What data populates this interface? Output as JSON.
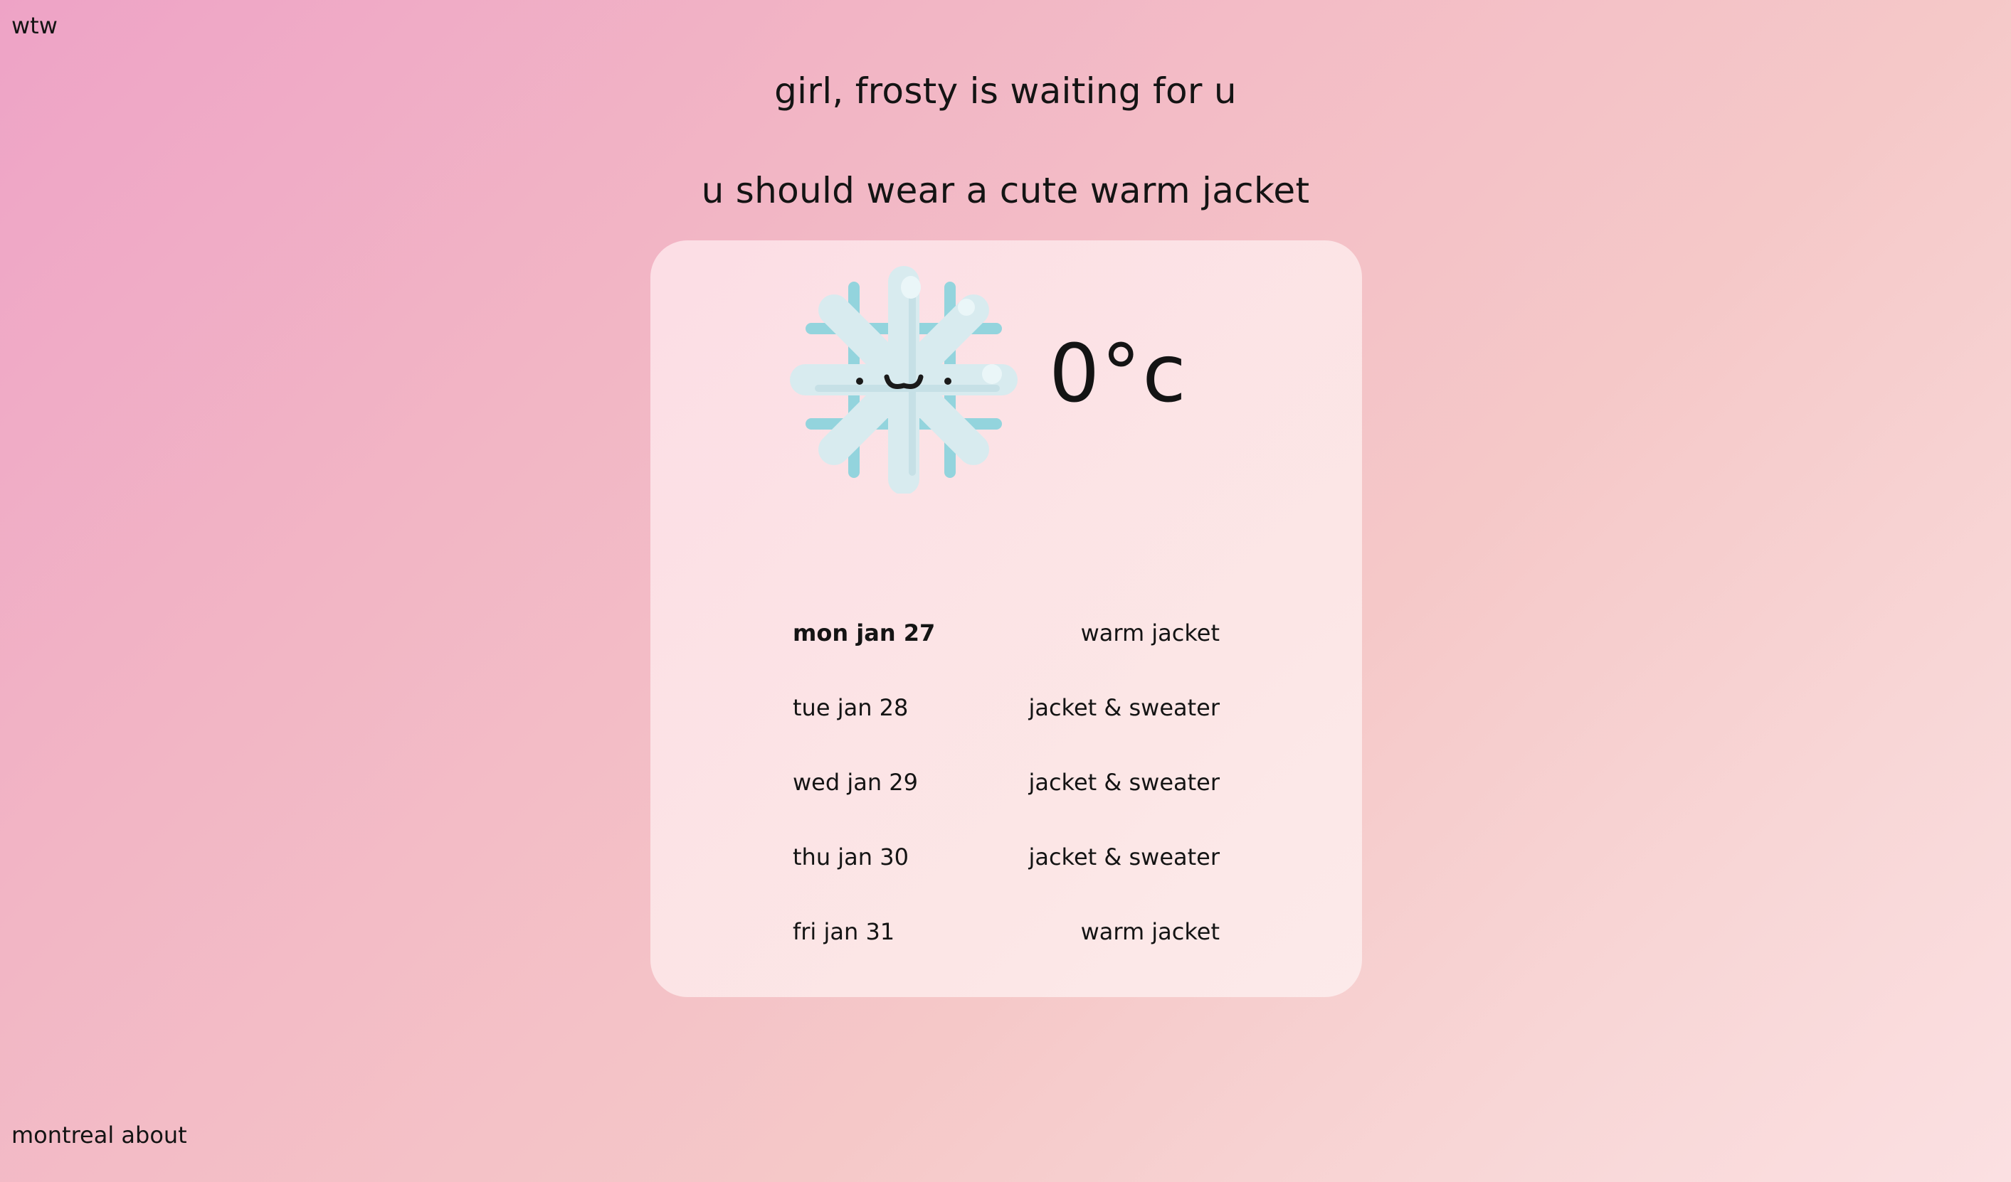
{
  "header": {
    "logo": "wtw"
  },
  "headline": {
    "line1": "girl, frosty is waiting for u",
    "line2": "u should wear a cute warm jacket"
  },
  "current": {
    "icon": "snowflake-face-icon",
    "temperature": "0°c"
  },
  "forecast": [
    {
      "day": "mon jan 27",
      "wear": "warm jacket"
    },
    {
      "day": "tue jan 28",
      "wear": "jacket & sweater"
    },
    {
      "day": "wed jan 29",
      "wear": "jacket & sweater"
    },
    {
      "day": "thu jan 30",
      "wear": "jacket & sweater"
    },
    {
      "day": "fri jan 31",
      "wear": "warm jacket"
    }
  ],
  "footer": {
    "city": "montreal",
    "about": "about"
  },
  "colors": {
    "gradient_start": "#eea3c6",
    "gradient_end": "#fbe0e2",
    "card": "#fce4e8",
    "snowflake_light": "#d9ecf0",
    "snowflake_teal": "#92d3dc",
    "text": "#141414"
  }
}
